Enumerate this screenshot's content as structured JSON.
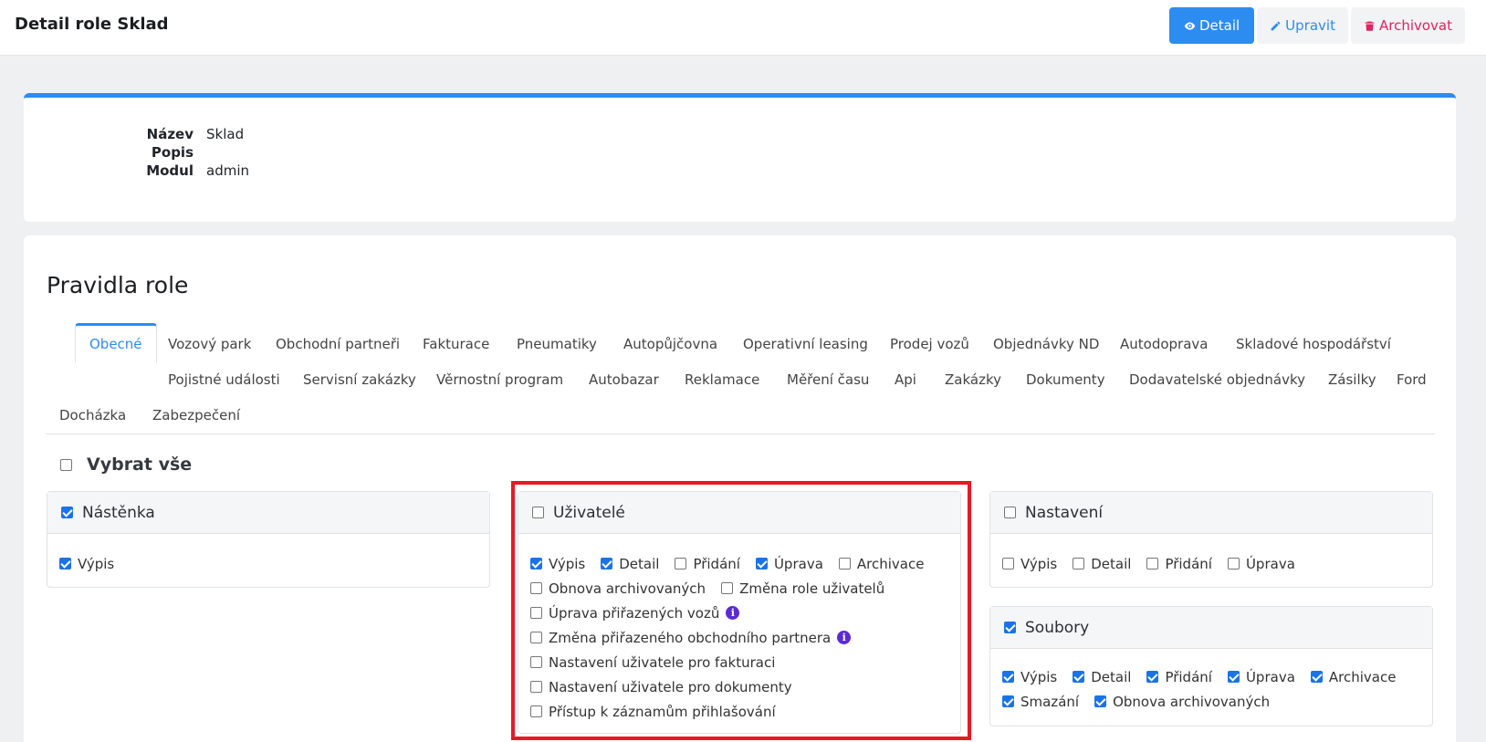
{
  "header": {
    "title": "Detail role Sklad",
    "detail_label": "Detail",
    "edit_label": "Upravit",
    "archive_label": "Archivovat"
  },
  "info": {
    "name_label": "Název",
    "name_value": "Sklad",
    "desc_label": "Popis",
    "desc_value": "",
    "module_label": "Modul",
    "module_value": "admin"
  },
  "rules": {
    "title": "Pravidla role",
    "select_all_label": "Vybrat vše",
    "tabs": [
      "Obecné",
      "Vozový park",
      "Obchodní partneři",
      "Fakturace",
      "Pneumatiky",
      "Autopůjčovna",
      "Operativní leasing",
      "Prodej vozů",
      "Objednávky ND",
      "Autodoprava",
      "Skladové hospodářství",
      "Pojistné události",
      "Servisní zakázky",
      "Věrnostní program",
      "Autobazar",
      "Reklamace",
      "Měření času",
      "Api",
      "Zakázky",
      "Dokumenty",
      "Dodavatelské objednávky",
      "Zásilky",
      "Ford",
      "Docházka",
      "Zabezpečení"
    ]
  },
  "panels": {
    "nastenka": {
      "title": "Nástěnka",
      "vypis": "Výpis"
    },
    "uzivatele": {
      "title": "Uživatelé",
      "vypis": "Výpis",
      "detail": "Detail",
      "pridani": "Přidání",
      "uprava": "Úprava",
      "archivace": "Archivace",
      "obnova": "Obnova archivovaných",
      "zmena_role": "Změna role uživatelů",
      "uprava_vozu": "Úprava přiřazených vozů",
      "zmena_partnera": "Změna přiřazeného obchodního partnera",
      "fakturace": "Nastavení uživatele pro fakturaci",
      "dokumenty": "Nastavení uživatele pro dokumenty",
      "prihlaseni": "Přístup k záznamům přihlašování"
    },
    "nastaveni": {
      "title": "Nastavení",
      "vypis": "Výpis",
      "detail": "Detail",
      "pridani": "Přidání",
      "uprava": "Úprava"
    },
    "soubory": {
      "title": "Soubory",
      "vypis": "Výpis",
      "detail": "Detail",
      "pridani": "Přidání",
      "uprava": "Úprava",
      "archivace": "Archivace",
      "smazani": "Smazání",
      "obnova": "Obnova archivovaných"
    }
  },
  "colors": {
    "accent": "#2d8cf0",
    "danger": "#e0245e",
    "highlight": "#e31b23",
    "info_icon": "#5b2bd6"
  }
}
